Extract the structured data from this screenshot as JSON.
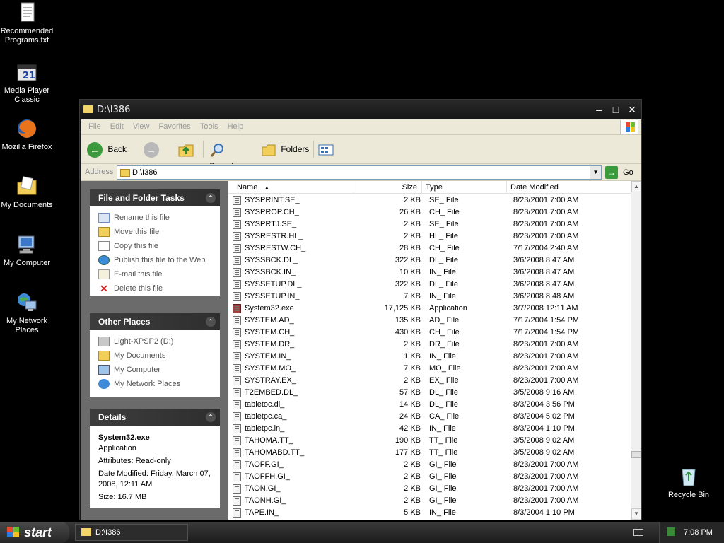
{
  "desktop": {
    "icons": [
      {
        "label": "Recommended Programs.txt",
        "icon": "text-file-icon"
      },
      {
        "label": "Media Player Classic",
        "icon": "media-player-icon"
      },
      {
        "label": "Mozilla Firefox",
        "icon": "firefox-icon"
      },
      {
        "label": "My Documents",
        "icon": "my-documents-icon"
      },
      {
        "label": "My Computer",
        "icon": "my-computer-icon"
      },
      {
        "label": "My Network Places",
        "icon": "network-places-icon"
      },
      {
        "label": "Recycle Bin",
        "icon": "recycle-bin-icon"
      }
    ]
  },
  "window": {
    "title": "D:\\I386",
    "menu": [
      "File",
      "Edit",
      "View",
      "Favorites",
      "Tools",
      "Help"
    ],
    "toolbar": {
      "back": "Back",
      "search": "Search",
      "folders": "Folders"
    },
    "address": {
      "label": "Address",
      "value": "D:\\I386",
      "go": "Go"
    }
  },
  "taskpane": {
    "file_tasks": {
      "title": "File and Folder Tasks",
      "items": [
        {
          "label": "Rename this file",
          "icon": "rename-icon"
        },
        {
          "label": "Move this file",
          "icon": "move-icon"
        },
        {
          "label": "Copy this file",
          "icon": "copy-icon"
        },
        {
          "label": "Publish this file to the Web",
          "icon": "publish-web-icon"
        },
        {
          "label": "E-mail this file",
          "icon": "email-icon"
        },
        {
          "label": "Delete this file",
          "icon": "delete-icon"
        }
      ]
    },
    "other_places": {
      "title": "Other Places",
      "items": [
        {
          "label": "Light-XPSP2 (D:)",
          "icon": "drive-icon"
        },
        {
          "label": "My Documents",
          "icon": "my-documents-icon"
        },
        {
          "label": "My Computer",
          "icon": "my-computer-icon"
        },
        {
          "label": "My Network Places",
          "icon": "network-places-icon"
        }
      ]
    },
    "details": {
      "title": "Details",
      "name": "System32.exe",
      "type": "Application",
      "attributes": "Attributes: Read-only",
      "modified": "Date Modified: Friday, March 07, 2008, 12:11 AM",
      "size": "Size: 16.7 MB"
    }
  },
  "filelist": {
    "columns": [
      "Name",
      "Size",
      "Type",
      "Date Modified"
    ],
    "rows": [
      {
        "name": "SYSPRINT.SE_",
        "size": "2 KB",
        "type": "SE_ File",
        "date": "8/23/2001 7:00 AM"
      },
      {
        "name": "SYSPROP.CH_",
        "size": "26 KB",
        "type": "CH_ File",
        "date": "8/23/2001 7:00 AM"
      },
      {
        "name": "SYSPRTJ.SE_",
        "size": "2 KB",
        "type": "SE_ File",
        "date": "8/23/2001 7:00 AM"
      },
      {
        "name": "SYSRESTR.HL_",
        "size": "2 KB",
        "type": "HL_ File",
        "date": "8/23/2001 7:00 AM"
      },
      {
        "name": "SYSRESTW.CH_",
        "size": "28 KB",
        "type": "CH_ File",
        "date": "7/17/2004 2:40 AM"
      },
      {
        "name": "SYSSBCK.DL_",
        "size": "322 KB",
        "type": "DL_ File",
        "date": "3/6/2008 8:47 AM"
      },
      {
        "name": "SYSSBCK.IN_",
        "size": "10 KB",
        "type": "IN_ File",
        "date": "3/6/2008 8:47 AM"
      },
      {
        "name": "SYSSETUP.DL_",
        "size": "322 KB",
        "type": "DL_ File",
        "date": "3/6/2008 8:47 AM"
      },
      {
        "name": "SYSSETUP.IN_",
        "size": "7 KB",
        "type": "IN_ File",
        "date": "3/6/2008 8:48 AM"
      },
      {
        "name": "System32.exe",
        "size": "17,125 KB",
        "type": "Application",
        "date": "3/7/2008 12:11 AM"
      },
      {
        "name": "SYSTEM.AD_",
        "size": "135 KB",
        "type": "AD_ File",
        "date": "7/17/2004 1:54 PM"
      },
      {
        "name": "SYSTEM.CH_",
        "size": "430 KB",
        "type": "CH_ File",
        "date": "7/17/2004 1:54 PM"
      },
      {
        "name": "SYSTEM.DR_",
        "size": "2 KB",
        "type": "DR_ File",
        "date": "8/23/2001 7:00 AM"
      },
      {
        "name": "SYSTEM.IN_",
        "size": "1 KB",
        "type": "IN_ File",
        "date": "8/23/2001 7:00 AM"
      },
      {
        "name": "SYSTEM.MO_",
        "size": "7 KB",
        "type": "MO_ File",
        "date": "8/23/2001 7:00 AM"
      },
      {
        "name": "SYSTRAY.EX_",
        "size": "2 KB",
        "type": "EX_ File",
        "date": "8/23/2001 7:00 AM"
      },
      {
        "name": "T2EMBED.DL_",
        "size": "57 KB",
        "type": "DL_ File",
        "date": "3/5/2008 9:16 AM"
      },
      {
        "name": "tabletoc.dl_",
        "size": "14 KB",
        "type": "DL_ File",
        "date": "8/3/2004 3:56 PM"
      },
      {
        "name": "tabletpc.ca_",
        "size": "24 KB",
        "type": "CA_ File",
        "date": "8/3/2004 5:02 PM"
      },
      {
        "name": "tabletpc.in_",
        "size": "42 KB",
        "type": "IN_ File",
        "date": "8/3/2004 1:10 PM"
      },
      {
        "name": "TAHOMA.TT_",
        "size": "190 KB",
        "type": "TT_ File",
        "date": "3/5/2008 9:02 AM"
      },
      {
        "name": "TAHOMABD.TT_",
        "size": "177 KB",
        "type": "TT_ File",
        "date": "3/5/2008 9:02 AM"
      },
      {
        "name": "TAOFF.GI_",
        "size": "2 KB",
        "type": "GI_ File",
        "date": "8/23/2001 7:00 AM"
      },
      {
        "name": "TAOFFH.GI_",
        "size": "2 KB",
        "type": "GI_ File",
        "date": "8/23/2001 7:00 AM"
      },
      {
        "name": "TAON.GI_",
        "size": "2 KB",
        "type": "GI_ File",
        "date": "8/23/2001 7:00 AM"
      },
      {
        "name": "TAONH.GI_",
        "size": "2 KB",
        "type": "GI_ File",
        "date": "8/23/2001 7:00 AM"
      },
      {
        "name": "TAPE.IN_",
        "size": "5 KB",
        "type": "IN_ File",
        "date": "8/3/2004 1:10 PM"
      }
    ]
  },
  "taskbar": {
    "start": "start",
    "task": "D:\\I386",
    "clock": "7:08 PM"
  }
}
